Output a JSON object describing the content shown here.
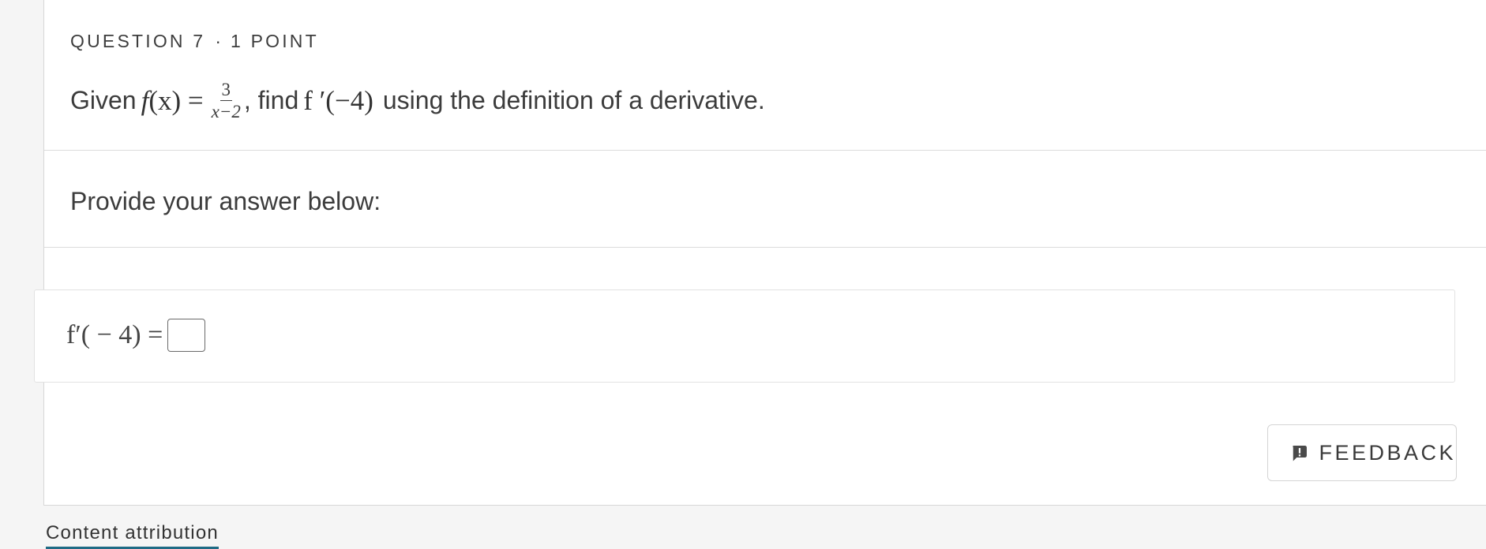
{
  "question": {
    "label": "QUESTION 7",
    "separator": "·",
    "points": "1 POINT",
    "text_given": "Given",
    "func_name": "f",
    "func_arg": "(x)",
    "equals": "=",
    "frac_num": "3",
    "frac_den": "x−2",
    "text_find": ", find",
    "derivative_expr": "f ′(−4)",
    "text_rest": "using the definition of a derivative."
  },
  "prompt": {
    "text": "Provide your answer below:"
  },
  "answer": {
    "lhs": "f′( − 4) =",
    "input_value": ""
  },
  "feedback": {
    "icon": "feedback-icon",
    "label": "FEEDBACK"
  },
  "footer": {
    "attribution_link": "Content attribution"
  }
}
